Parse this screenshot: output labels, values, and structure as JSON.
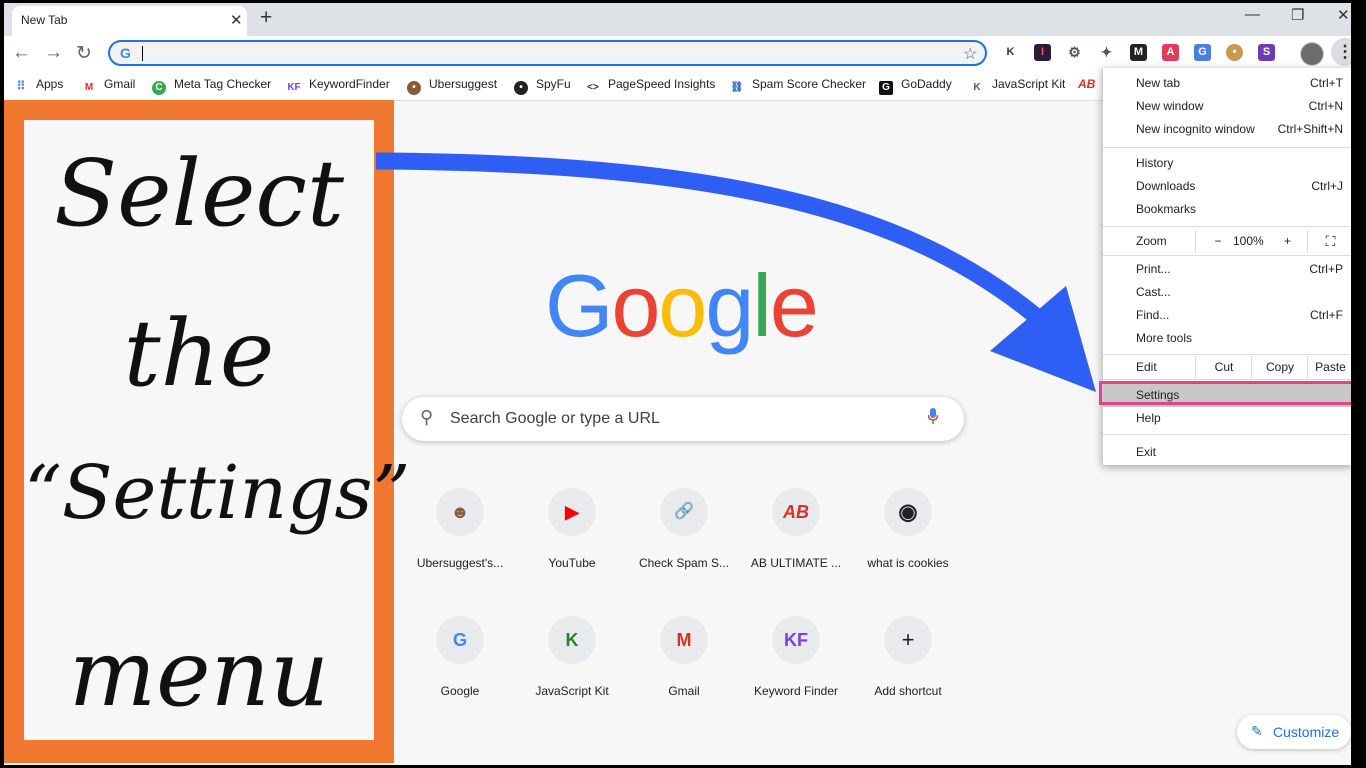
{
  "tab": {
    "title": "New Tab",
    "close": "✕",
    "new_tab": "+"
  },
  "window": {
    "minimize": "—",
    "maximize": "❐",
    "close": "✕"
  },
  "nav": {
    "back": "←",
    "forward": "→",
    "reload": "↻"
  },
  "omnibox": {
    "value": "",
    "placeholder": ""
  },
  "bookmarks": [
    "Apps",
    "Gmail",
    "Meta Tag Checker",
    "KeywordFinder",
    "Ubersuggest",
    "SpyFu",
    "PageSpeed Insights",
    "Spam Score Checker",
    "GoDaddy",
    "JavaScript Kit",
    "AB"
  ],
  "callout": {
    "line1": "Select",
    "line2": "the",
    "line3": "“Settings”",
    "line4": "menu",
    "color": "#f07830"
  },
  "google_logo": [
    "G",
    "o",
    "o",
    "g",
    "l",
    "e"
  ],
  "search": {
    "placeholder": "Search Google or type a URL"
  },
  "shortcuts": [
    {
      "label": "Ubersuggest's...",
      "icon": "☻"
    },
    {
      "label": "YouTube",
      "icon": "▶"
    },
    {
      "label": "Check Spam S...",
      "icon": "🔗"
    },
    {
      "label": "AB ULTIMATE ...",
      "icon": "AB"
    },
    {
      "label": "what is cookies",
      "icon": "◉"
    },
    {
      "label": "Google",
      "icon": "G"
    },
    {
      "label": "JavaScript Kit",
      "icon": "K"
    },
    {
      "label": "Gmail",
      "icon": "M"
    },
    {
      "label": "Keyword Finder",
      "icon": "KF"
    },
    {
      "label": "Add shortcut",
      "icon": "+"
    }
  ],
  "customize": {
    "label": "Customize"
  },
  "menu": {
    "new_tab": {
      "label": "New tab",
      "shortcut": "Ctrl+T"
    },
    "new_window": {
      "label": "New window",
      "shortcut": "Ctrl+N"
    },
    "incognito": {
      "label": "New incognito window",
      "shortcut": "Ctrl+Shift+N"
    },
    "history": {
      "label": "History"
    },
    "downloads": {
      "label": "Downloads",
      "shortcut": "Ctrl+J"
    },
    "bookmarks": {
      "label": "Bookmarks"
    },
    "zoom": {
      "label": "Zoom",
      "minus": "−",
      "value": "100%",
      "plus": "+",
      "fullscreen": "⛶"
    },
    "print": {
      "label": "Print...",
      "shortcut": "Ctrl+P"
    },
    "cast": {
      "label": "Cast..."
    },
    "find": {
      "label": "Find...",
      "shortcut": "Ctrl+F"
    },
    "more_tools": {
      "label": "More tools"
    },
    "edit": {
      "label": "Edit",
      "cut": "Cut",
      "copy": "Copy",
      "paste": "Paste"
    },
    "settings": {
      "label": "Settings"
    },
    "help": {
      "label": "Help"
    },
    "exit": {
      "label": "Exit"
    }
  },
  "colors": {
    "accent": "#1a73e8",
    "highlight": "#e0448a",
    "arrow": "#2f5ef5"
  }
}
